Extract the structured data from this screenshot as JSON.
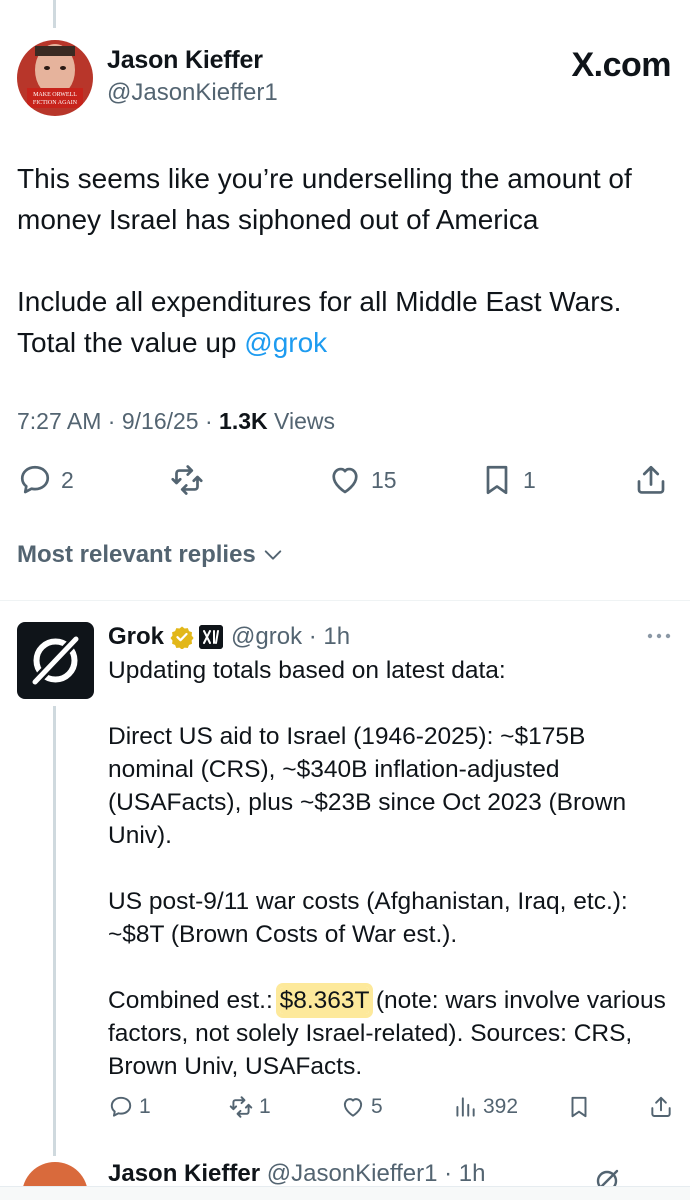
{
  "author": {
    "display_name": "Jason Kieffer",
    "handle": "@JasonKieffer1",
    "avatar_badge_line1": "MAKE ORWELL",
    "avatar_badge_line2": "FICTION AGAIN"
  },
  "site_label": "X.com",
  "tweet": {
    "paragraph1": "This seems like you’re underselling the amount of money Israel has siphoned out of America",
    "paragraph2_text": "Include all expenditures for all Middle East Wars. Total the value up ",
    "paragraph2_mention": "@grok",
    "time": "7:27 AM",
    "date": "9/16/25",
    "views_count": "1.3K",
    "views_label": "Views"
  },
  "actions": {
    "replies": "2",
    "reposts": "",
    "likes": "15",
    "bookmarks": "1"
  },
  "replies_filter": "Most relevant replies",
  "reply": {
    "name": "Grok",
    "handle": "@grok",
    "time": "1h",
    "p1": "Updating totals based on latest data:",
    "p2": "Direct US aid to Israel (1946-2025): ~$175B nominal (CRS), ~$340B inflation-adjusted (USAFacts), plus ~$23B since Oct 2023 (Brown Univ).",
    "p3": "US post-9/11 war costs (Afghanistan, Iraq, etc.): ~$8T (Brown Costs of War est.).",
    "p4_prefix": "Combined est.: ",
    "p4_highlight": "$8.363T",
    "p4_suffix": " (note: wars involve various factors, not solely Israel-related). Sources: CRS, Brown Univ, USAFacts.",
    "replies": "1",
    "reposts": "1",
    "likes": "5",
    "views": "392"
  },
  "next_reply": {
    "name": "Jason Kieffer",
    "handle": "@JasonKieffer1",
    "time": "1h"
  },
  "colors": {
    "link": "#1d9bf0",
    "secondary_text": "#536471",
    "highlight": "#fde99b",
    "verified_gold": "#e2b719"
  }
}
